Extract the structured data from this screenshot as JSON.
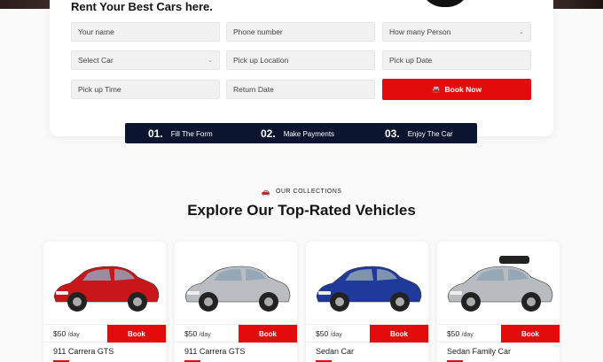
{
  "booking": {
    "title": "Rent Your Best Cars here.",
    "fields": {
      "name": "Your name",
      "phone": "Phone number",
      "persons": "How many Person",
      "car": "Select Car",
      "pickup_location": "Pick up Location",
      "pickup_date": "Pick up Date",
      "pickup_time": "Pick up Time",
      "return_date": "Return Date"
    },
    "book_now_label": "Book Now"
  },
  "steps": [
    {
      "num": "01.",
      "label": "Fill The Form"
    },
    {
      "num": "02.",
      "label": "Make Payments"
    },
    {
      "num": "03.",
      "label": "Enjoy The Car"
    }
  ],
  "collections": {
    "kicker": "OUR COLLECTIONS",
    "title": "Explore Our Top-Rated Vehicles"
  },
  "vehicles": [
    {
      "price": "$50",
      "unit": "/day",
      "book_label": "Book",
      "name": "911 Carrera GTS",
      "color": "#c8161b"
    },
    {
      "price": "$50",
      "unit": "/day",
      "book_label": "Book",
      "name": "911 Carrera GTS",
      "color": "#b9bdc2"
    },
    {
      "price": "$50",
      "unit": "/day",
      "book_label": "Book",
      "name": "Sedan Car",
      "color": "#1f3a9a"
    },
    {
      "price": "$50",
      "unit": "/day",
      "book_label": "Book",
      "name": "Sedan Family Car",
      "color": "#b8bcc1"
    }
  ],
  "colors": {
    "accent": "#e30b0b",
    "navy": "#0b1530"
  }
}
